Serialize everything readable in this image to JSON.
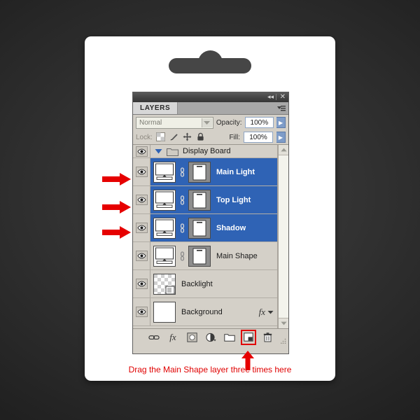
{
  "window": {
    "panel_title": "LAYERS",
    "collapse_icon": "collapse-icon",
    "close_icon": "close-icon",
    "menu_icon": "panel-menu-icon"
  },
  "options": {
    "blend_mode_value": "Normal",
    "blend_mode_caret": "chevron-down-icon",
    "opacity_label": "Opacity:",
    "opacity_value": "100%",
    "fill_label": "Fill:",
    "fill_value": "100%",
    "lock_label": "Lock:",
    "lock_icons": [
      "lock-transparency-icon",
      "lock-image-pixels-icon",
      "lock-position-icon",
      "lock-all-icon"
    ]
  },
  "layers": [
    {
      "name": "Display Board",
      "type": "group",
      "selected": false,
      "visible": true,
      "expanded": true,
      "thumb": "folder-icon",
      "has_mask": false,
      "has_fx": false
    },
    {
      "name": "Main Light",
      "type": "layer",
      "selected": true,
      "visible": true,
      "thumb": "display-board-thumbnail",
      "has_mask": true,
      "has_fx": false
    },
    {
      "name": "Top Light",
      "type": "layer",
      "selected": true,
      "visible": true,
      "thumb": "display-board-thumbnail",
      "has_mask": true,
      "has_fx": false
    },
    {
      "name": "Shadow",
      "type": "layer",
      "selected": true,
      "visible": true,
      "thumb": "display-board-thumbnail",
      "has_mask": true,
      "has_fx": false
    },
    {
      "name": "Main Shape",
      "type": "layer",
      "selected": false,
      "visible": true,
      "thumb": "display-board-thumbnail",
      "has_mask": true,
      "has_fx": false
    },
    {
      "name": "Backlight",
      "type": "layer",
      "selected": false,
      "visible": true,
      "thumb": "transparent-checker-thumbnail",
      "has_mask": false,
      "has_fx": false
    },
    {
      "name": "Background",
      "type": "layer",
      "selected": false,
      "visible": true,
      "thumb": "white-thumbnail",
      "has_mask": false,
      "has_fx": true,
      "fx_label": "fx"
    }
  ],
  "footer_buttons": [
    {
      "name": "link-layers-icon"
    },
    {
      "name": "add-layer-style-icon",
      "label": "fx"
    },
    {
      "name": "add-layer-mask-icon"
    },
    {
      "name": "new-fill-adjustment-layer-icon"
    },
    {
      "name": "new-group-icon"
    },
    {
      "name": "new-layer-icon"
    },
    {
      "name": "delete-layer-icon"
    }
  ],
  "annotation": {
    "caption": "Drag the Main Shape layer three times here",
    "accent_color": "#e00000",
    "arrow_rows": [
      "Main Light",
      "Top Light",
      "Shadow"
    ],
    "arrow_target": "new-layer-icon"
  },
  "colors": {
    "selection_blue": "#2f63b5",
    "panel_gray": "#d4d0c8",
    "titlebar_dark": "#454545",
    "annotation_red": "#e00000",
    "card_white": "#ffffff",
    "backdrop_dark": "#2b2b2b"
  }
}
